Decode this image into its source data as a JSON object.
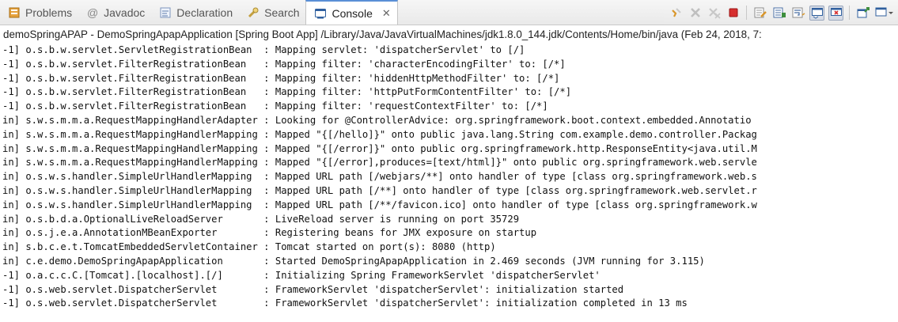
{
  "tabs": [
    {
      "label": "Problems",
      "icon": "problems-icon",
      "active": false
    },
    {
      "label": "Javadoc",
      "icon": "javadoc-icon",
      "active": false
    },
    {
      "label": "Declaration",
      "icon": "declaration-icon",
      "active": false
    },
    {
      "label": "Search",
      "icon": "search-icon",
      "active": false
    },
    {
      "label": "Console",
      "icon": "console-icon",
      "active": true
    }
  ],
  "toolbar": {
    "icons": [
      "remove-launch-icon",
      "remove-all-terminated-icon",
      "remove-terminated-icon",
      "terminate-icon",
      "clear-console-icon",
      "scroll-lock-icon",
      "word-wrap-icon",
      "show-on-stdout-icon",
      "show-on-stderr-icon",
      "pin-console-icon",
      "display-console-icon"
    ],
    "colors": {
      "terminate": "#d62f2f",
      "tab_accent": "#5a8fd6"
    }
  },
  "console": {
    "header": "demoSpringAPAP - DemoSpringApapApplication [Spring Boot App] /Library/Java/JavaVirtualMachines/jdk1.8.0_144.jdk/Contents/Home/bin/java (Feb 24, 2018, 7:",
    "lines": [
      "-1] o.s.b.w.servlet.ServletRegistrationBean  : Mapping servlet: 'dispatcherServlet' to [/]",
      "-1] o.s.b.w.servlet.FilterRegistrationBean   : Mapping filter: 'characterEncodingFilter' to: [/*]",
      "-1] o.s.b.w.servlet.FilterRegistrationBean   : Mapping filter: 'hiddenHttpMethodFilter' to: [/*]",
      "-1] o.s.b.w.servlet.FilterRegistrationBean   : Mapping filter: 'httpPutFormContentFilter' to: [/*]",
      "-1] o.s.b.w.servlet.FilterRegistrationBean   : Mapping filter: 'requestContextFilter' to: [/*]",
      "in] s.w.s.m.m.a.RequestMappingHandlerAdapter : Looking for @ControllerAdvice: org.springframework.boot.context.embedded.Annotatio",
      "in] s.w.s.m.m.a.RequestMappingHandlerMapping : Mapped \"{[/hello]}\" onto public java.lang.String com.example.demo.controller.Packag",
      "in] s.w.s.m.m.a.RequestMappingHandlerMapping : Mapped \"{[/error]}\" onto public org.springframework.http.ResponseEntity<java.util.M",
      "in] s.w.s.m.m.a.RequestMappingHandlerMapping : Mapped \"{[/error],produces=[text/html]}\" onto public org.springframework.web.servle",
      "in] o.s.w.s.handler.SimpleUrlHandlerMapping  : Mapped URL path [/webjars/**] onto handler of type [class org.springframework.web.s",
      "in] o.s.w.s.handler.SimpleUrlHandlerMapping  : Mapped URL path [/**] onto handler of type [class org.springframework.web.servlet.r",
      "in] o.s.w.s.handler.SimpleUrlHandlerMapping  : Mapped URL path [/**/favicon.ico] onto handler of type [class org.springframework.w",
      "in] o.s.b.d.a.OptionalLiveReloadServer       : LiveReload server is running on port 35729",
      "in] o.s.j.e.a.AnnotationMBeanExporter        : Registering beans for JMX exposure on startup",
      "in] s.b.c.e.t.TomcatEmbeddedServletContainer : Tomcat started on port(s): 8080 (http)",
      "in] c.e.demo.DemoSpringApapApplication       : Started DemoSpringApapApplication in 2.469 seconds (JVM running for 3.115)",
      "-1] o.a.c.c.C.[Tomcat].[localhost].[/]       : Initializing Spring FrameworkServlet 'dispatcherServlet'",
      "-1] o.s.web.servlet.DispatcherServlet        : FrameworkServlet 'dispatcherServlet': initialization started",
      "-1] o.s.web.servlet.DispatcherServlet        : FrameworkServlet 'dispatcherServlet': initialization completed in 13 ms"
    ]
  }
}
